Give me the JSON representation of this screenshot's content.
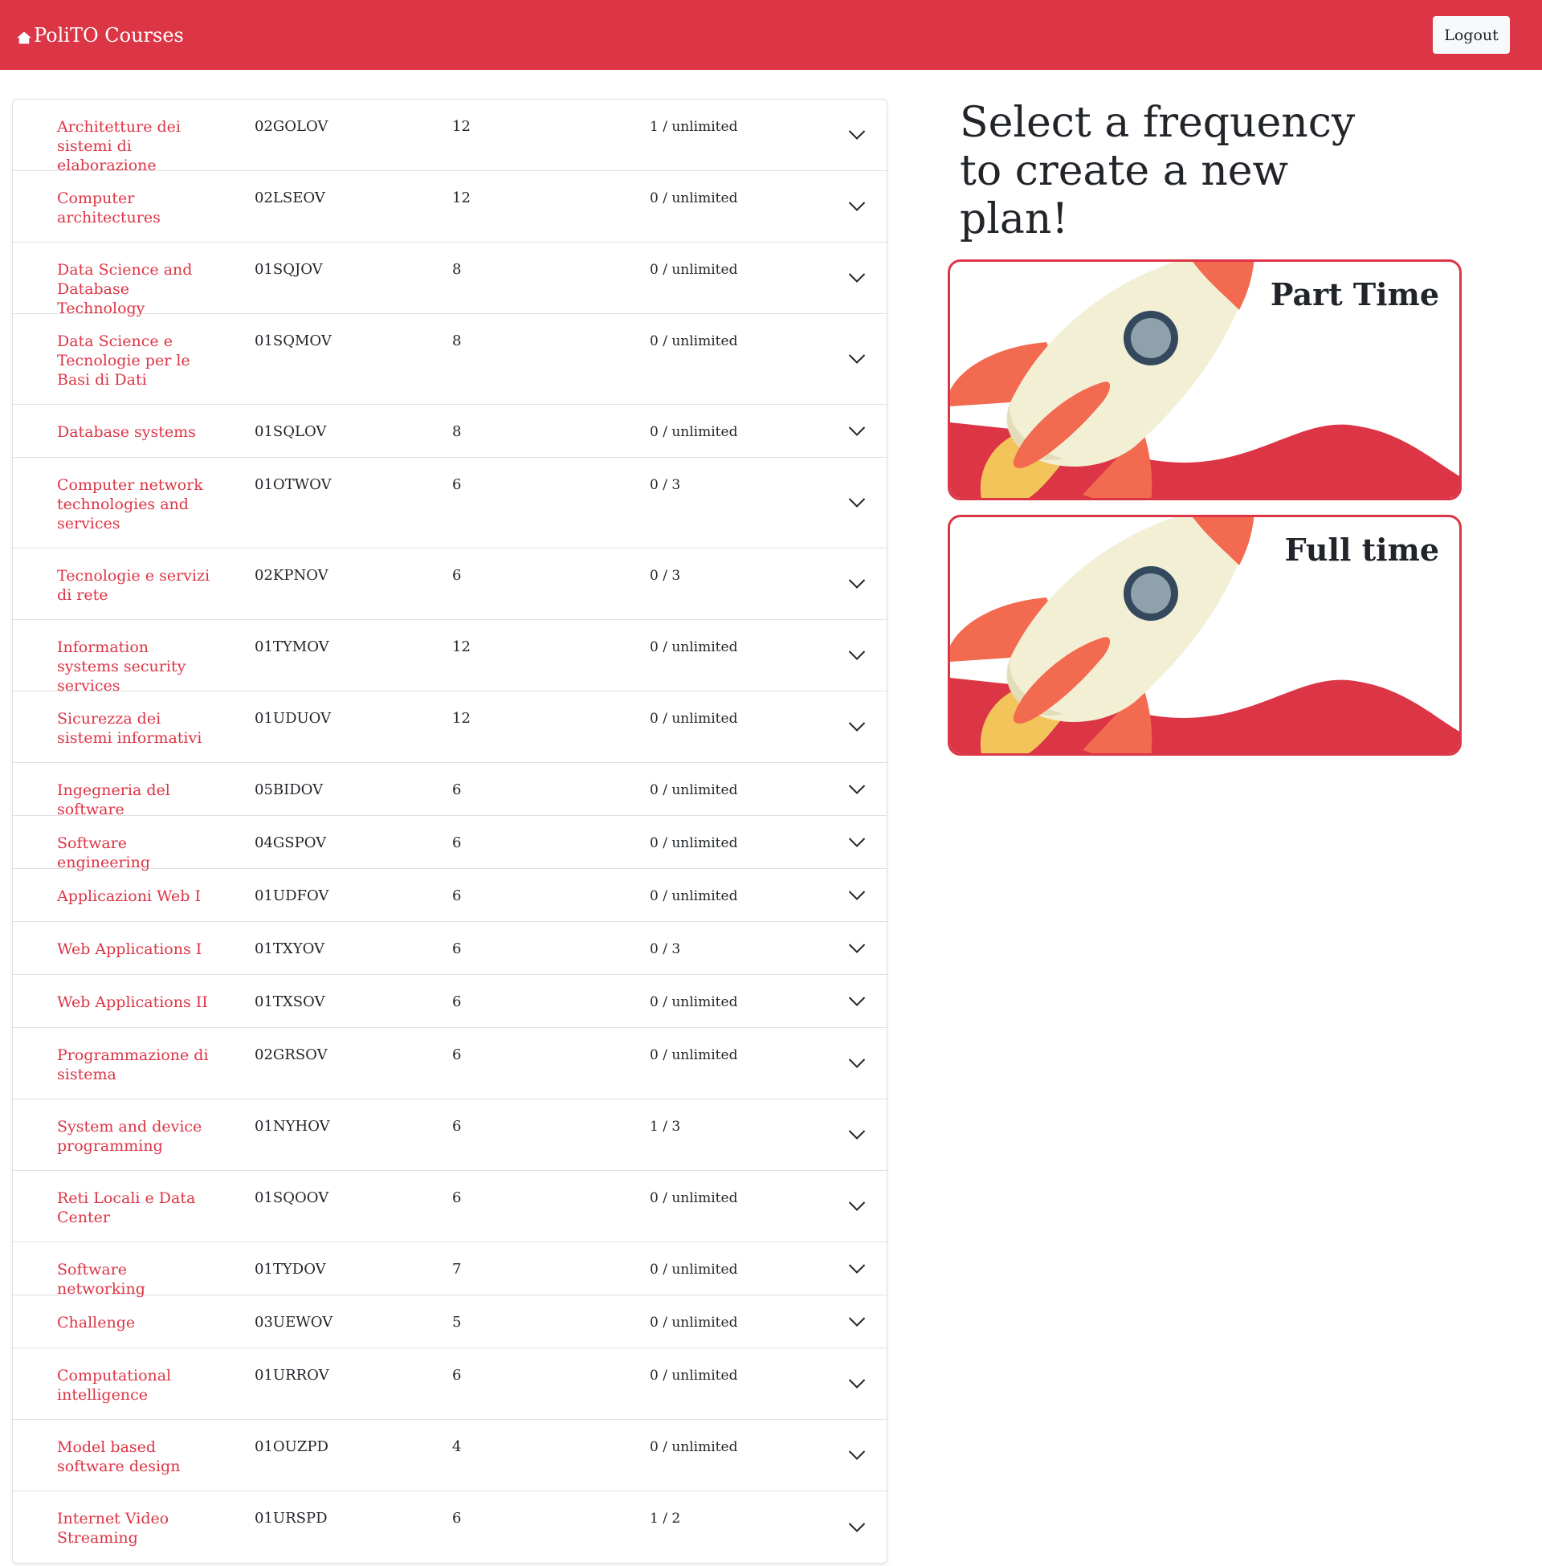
{
  "navbar": {
    "brand": "PoliTO Courses",
    "logout_label": "Logout",
    "color": "#dc3545"
  },
  "courses": [
    {
      "name": "Architetture dei sistemi di elaborazione",
      "code": "02GOLOV",
      "credits": "12",
      "students": "1 / unlimited"
    },
    {
      "name": "Computer architectures",
      "code": "02LSEOV",
      "credits": "12",
      "students": "0 / unlimited"
    },
    {
      "name": "Data Science and Database Technology",
      "code": "01SQJOV",
      "credits": "8",
      "students": "0 / unlimited"
    },
    {
      "name": "Data Science e Tecnologie per le Basi di Dati",
      "code": "01SQMOV",
      "credits": "8",
      "students": "0 / unlimited"
    },
    {
      "name": "Database systems",
      "code": "01SQLOV",
      "credits": "8",
      "students": "0 / unlimited"
    },
    {
      "name": "Computer network technologies and services",
      "code": "01OTWOV",
      "credits": "6",
      "students": "0 / 3"
    },
    {
      "name": "Tecnologie e servizi di rete",
      "code": "02KPNOV",
      "credits": "6",
      "students": "0 / 3"
    },
    {
      "name": "Information systems security services",
      "code": "01TYMOV",
      "credits": "12",
      "students": "0 / unlimited"
    },
    {
      "name": "Sicurezza dei sistemi informativi",
      "code": "01UDUOV",
      "credits": "12",
      "students": "0 / unlimited"
    },
    {
      "name": "Ingegneria del software",
      "code": "05BIDOV",
      "credits": "6",
      "students": "0 / unlimited"
    },
    {
      "name": "Software engineering",
      "code": "04GSPOV",
      "credits": "6",
      "students": "0 / unlimited"
    },
    {
      "name": "Applicazioni Web I",
      "code": "01UDFOV",
      "credits": "6",
      "students": "0 / unlimited"
    },
    {
      "name": "Web Applications I",
      "code": "01TXYOV",
      "credits": "6",
      "students": "0 / 3"
    },
    {
      "name": "Web Applications II",
      "code": "01TXSOV",
      "credits": "6",
      "students": "0 / unlimited"
    },
    {
      "name": "Programmazione di sistema",
      "code": "02GRSOV",
      "credits": "6",
      "students": "0 / unlimited"
    },
    {
      "name": "System and device programming",
      "code": "01NYHOV",
      "credits": "6",
      "students": "1 / 3"
    },
    {
      "name": "Reti Locali e Data Center",
      "code": "01SQOOV",
      "credits": "6",
      "students": "0 / unlimited"
    },
    {
      "name": "Software networking",
      "code": "01TYDOV",
      "credits": "7",
      "students": "0 / unlimited"
    },
    {
      "name": "Challenge",
      "code": "03UEWOV",
      "credits": "5",
      "students": "0 / unlimited"
    },
    {
      "name": "Computational intelligence",
      "code": "01URROV",
      "credits": "6",
      "students": "0 / unlimited"
    },
    {
      "name": "Model based software design",
      "code": "01OUZPD",
      "credits": "4",
      "students": "0 / unlimited"
    },
    {
      "name": "Internet Video Streaming",
      "code": "01URSPD",
      "credits": "6",
      "students": "1 / 2"
    }
  ],
  "frequency": {
    "headline": "Select a frequency to create a new plan!",
    "options": [
      {
        "label": "Part Time"
      },
      {
        "label": "Full time"
      }
    ]
  }
}
